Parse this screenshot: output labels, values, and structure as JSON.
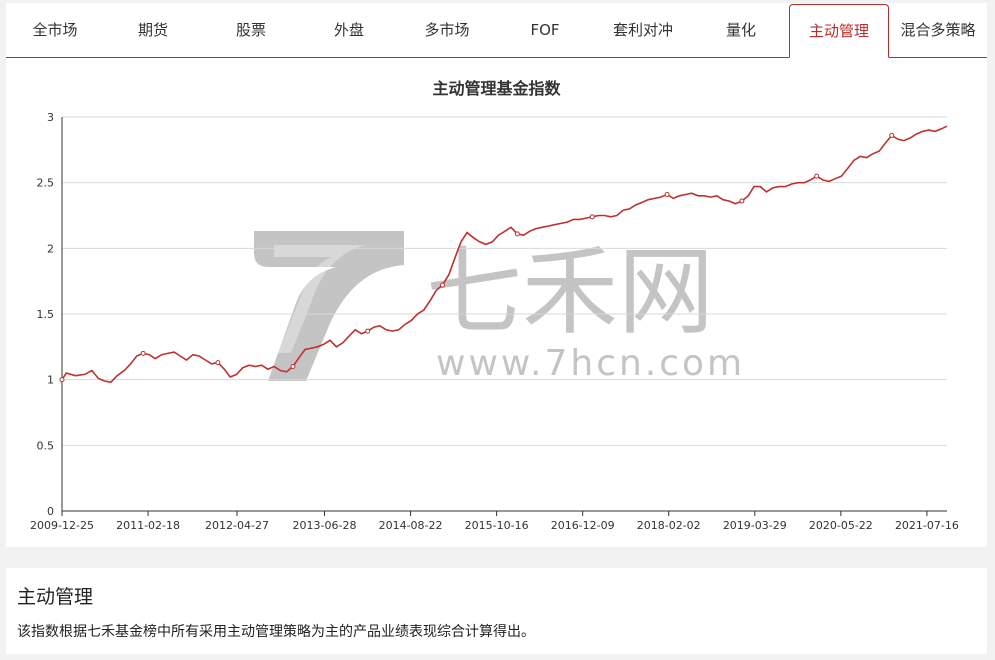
{
  "tabs": [
    {
      "label": "全市场",
      "active": false
    },
    {
      "label": "期货",
      "active": false
    },
    {
      "label": "股票",
      "active": false
    },
    {
      "label": "外盘",
      "active": false
    },
    {
      "label": "多市场",
      "active": false
    },
    {
      "label": "FOF",
      "active": false
    },
    {
      "label": "套利对冲",
      "active": false
    },
    {
      "label": "量化",
      "active": false
    },
    {
      "label": "主动管理",
      "active": true
    },
    {
      "label": "混合多策略",
      "active": false
    }
  ],
  "watermark": {
    "brand": "七禾网",
    "url": "www.7hcn.com"
  },
  "colors": {
    "accent": "#b92c2c",
    "line": "#c0302f",
    "grid": "#d9d9d9"
  },
  "chart_data": {
    "type": "line",
    "title": "主动管理基金指数",
    "ylim": [
      0,
      3
    ],
    "yticks": [
      "0",
      "0.5",
      "1",
      "1.5",
      "2",
      "2.5",
      "3"
    ],
    "x_tick_labels": [
      "2009-12-25",
      "2011-02-18",
      "2012-04-27",
      "2013-06-28",
      "2014-08-22",
      "2015-10-16",
      "2016-12-09",
      "2018-02-02",
      "2019-03-29",
      "2020-05-22",
      "2021-07-16"
    ],
    "x_range": [
      "2009-12-25",
      "2021-10-22"
    ],
    "grid": true,
    "series": [
      {
        "points": [
          [
            "2009-12-25",
            1.0
          ],
          [
            "2010-01-15",
            1.05
          ],
          [
            "2010-03-01",
            1.03
          ],
          [
            "2010-04-15",
            1.04
          ],
          [
            "2010-05-20",
            1.07
          ],
          [
            "2010-06-20",
            1.01
          ],
          [
            "2010-07-20",
            0.99
          ],
          [
            "2010-08-20",
            0.98
          ],
          [
            "2010-09-20",
            1.03
          ],
          [
            "2010-10-25",
            1.07
          ],
          [
            "2010-11-25",
            1.12
          ],
          [
            "2010-12-25",
            1.18
          ],
          [
            "2011-01-25",
            1.2
          ],
          [
            "2011-02-25",
            1.19
          ],
          [
            "2011-03-25",
            1.16
          ],
          [
            "2011-04-25",
            1.19
          ],
          [
            "2011-05-25",
            1.2
          ],
          [
            "2011-06-25",
            1.21
          ],
          [
            "2011-07-25",
            1.18
          ],
          [
            "2011-08-25",
            1.15
          ],
          [
            "2011-09-25",
            1.19
          ],
          [
            "2011-10-25",
            1.18
          ],
          [
            "2011-11-25",
            1.15
          ],
          [
            "2011-12-25",
            1.12
          ],
          [
            "2012-01-25",
            1.13
          ],
          [
            "2012-02-25",
            1.08
          ],
          [
            "2012-03-25",
            1.02
          ],
          [
            "2012-04-25",
            1.04
          ],
          [
            "2012-05-25",
            1.09
          ],
          [
            "2012-06-25",
            1.11
          ],
          [
            "2012-07-25",
            1.1
          ],
          [
            "2012-08-25",
            1.11
          ],
          [
            "2012-09-25",
            1.08
          ],
          [
            "2012-10-25",
            1.1
          ],
          [
            "2012-11-25",
            1.07
          ],
          [
            "2012-12-25",
            1.06
          ],
          [
            "2013-01-25",
            1.1
          ],
          [
            "2013-02-25",
            1.17
          ],
          [
            "2013-03-25",
            1.23
          ],
          [
            "2013-04-25",
            1.24
          ],
          [
            "2013-05-25",
            1.25
          ],
          [
            "2013-06-25",
            1.27
          ],
          [
            "2013-07-25",
            1.3
          ],
          [
            "2013-08-25",
            1.25
          ],
          [
            "2013-09-25",
            1.28
          ],
          [
            "2013-10-25",
            1.33
          ],
          [
            "2013-11-25",
            1.38
          ],
          [
            "2013-12-25",
            1.35
          ],
          [
            "2014-01-25",
            1.37
          ],
          [
            "2014-02-25",
            1.4
          ],
          [
            "2014-03-25",
            1.41
          ],
          [
            "2014-04-25",
            1.38
          ],
          [
            "2014-05-25",
            1.37
          ],
          [
            "2014-06-25",
            1.38
          ],
          [
            "2014-07-25",
            1.42
          ],
          [
            "2014-08-25",
            1.45
          ],
          [
            "2014-09-25",
            1.5
          ],
          [
            "2014-10-25",
            1.53
          ],
          [
            "2014-11-25",
            1.6
          ],
          [
            "2014-12-25",
            1.68
          ],
          [
            "2015-01-25",
            1.72
          ],
          [
            "2015-02-25",
            1.8
          ],
          [
            "2015-03-25",
            1.92
          ],
          [
            "2015-04-25",
            2.05
          ],
          [
            "2015-05-25",
            2.12
          ],
          [
            "2015-06-25",
            2.08
          ],
          [
            "2015-07-25",
            2.05
          ],
          [
            "2015-08-25",
            2.03
          ],
          [
            "2015-09-25",
            2.05
          ],
          [
            "2015-10-25",
            2.1
          ],
          [
            "2015-11-25",
            2.13
          ],
          [
            "2015-12-25",
            2.16
          ],
          [
            "2016-01-25",
            2.11
          ],
          [
            "2016-02-25",
            2.1
          ],
          [
            "2016-03-25",
            2.13
          ],
          [
            "2016-04-25",
            2.15
          ],
          [
            "2016-05-25",
            2.16
          ],
          [
            "2016-06-25",
            2.17
          ],
          [
            "2016-07-25",
            2.18
          ],
          [
            "2016-08-25",
            2.19
          ],
          [
            "2016-09-25",
            2.2
          ],
          [
            "2016-10-25",
            2.22
          ],
          [
            "2016-11-25",
            2.22
          ],
          [
            "2016-12-25",
            2.23
          ],
          [
            "2017-01-25",
            2.24
          ],
          [
            "2017-02-25",
            2.25
          ],
          [
            "2017-03-25",
            2.25
          ],
          [
            "2017-04-25",
            2.24
          ],
          [
            "2017-05-25",
            2.25
          ],
          [
            "2017-06-25",
            2.29
          ],
          [
            "2017-07-25",
            2.3
          ],
          [
            "2017-08-25",
            2.33
          ],
          [
            "2017-09-25",
            2.35
          ],
          [
            "2017-10-25",
            2.37
          ],
          [
            "2017-11-25",
            2.38
          ],
          [
            "2017-12-25",
            2.39
          ],
          [
            "2018-01-25",
            2.41
          ],
          [
            "2018-02-25",
            2.38
          ],
          [
            "2018-03-25",
            2.4
          ],
          [
            "2018-04-25",
            2.41
          ],
          [
            "2018-05-25",
            2.42
          ],
          [
            "2018-06-25",
            2.4
          ],
          [
            "2018-07-25",
            2.4
          ],
          [
            "2018-08-25",
            2.39
          ],
          [
            "2018-09-25",
            2.4
          ],
          [
            "2018-10-25",
            2.37
          ],
          [
            "2018-11-25",
            2.36
          ],
          [
            "2018-12-25",
            2.34
          ],
          [
            "2019-01-25",
            2.36
          ],
          [
            "2019-02-25",
            2.4
          ],
          [
            "2019-03-25",
            2.47
          ],
          [
            "2019-04-25",
            2.47
          ],
          [
            "2019-05-25",
            2.43
          ],
          [
            "2019-06-25",
            2.46
          ],
          [
            "2019-07-25",
            2.47
          ],
          [
            "2019-08-25",
            2.47
          ],
          [
            "2019-09-25",
            2.49
          ],
          [
            "2019-10-25",
            2.5
          ],
          [
            "2019-11-25",
            2.5
          ],
          [
            "2019-12-25",
            2.52
          ],
          [
            "2020-01-25",
            2.55
          ],
          [
            "2020-02-25",
            2.52
          ],
          [
            "2020-03-25",
            2.51
          ],
          [
            "2020-04-25",
            2.53
          ],
          [
            "2020-05-25",
            2.55
          ],
          [
            "2020-06-25",
            2.61
          ],
          [
            "2020-07-25",
            2.67
          ],
          [
            "2020-08-25",
            2.7
          ],
          [
            "2020-09-25",
            2.69
          ],
          [
            "2020-10-25",
            2.72
          ],
          [
            "2020-11-25",
            2.74
          ],
          [
            "2020-12-25",
            2.8
          ],
          [
            "2021-01-25",
            2.86
          ],
          [
            "2021-02-25",
            2.83
          ],
          [
            "2021-03-25",
            2.82
          ],
          [
            "2021-04-25",
            2.84
          ],
          [
            "2021-05-25",
            2.87
          ],
          [
            "2021-06-25",
            2.89
          ],
          [
            "2021-07-25",
            2.9
          ],
          [
            "2021-08-25",
            2.89
          ],
          [
            "2021-09-25",
            2.91
          ],
          [
            "2021-10-22",
            2.93
          ]
        ]
      }
    ]
  },
  "section": {
    "title": "主动管理",
    "description": "该指数根据七禾基金榜中所有采用主动管理策略为主的产品业绩表现综合计算得出。"
  }
}
